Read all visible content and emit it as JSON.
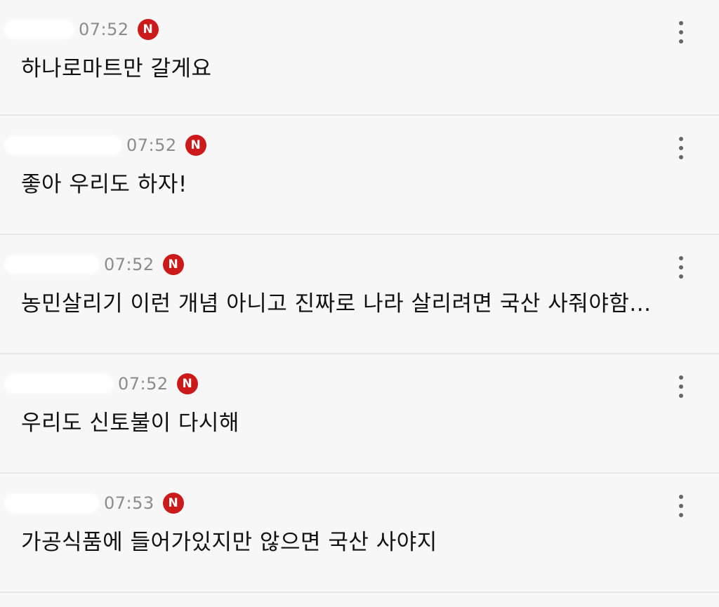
{
  "comments": [
    {
      "time": "07:52",
      "badge": "N",
      "text": "하나로마트만 갈게요"
    },
    {
      "time": "07:52",
      "badge": "N",
      "text": "좋아 우리도 하자!"
    },
    {
      "time": "07:52",
      "badge": "N",
      "text": "농민살리기 이런 개념 아니고 진짜로 나라 살리려면 국산 사줘야함..."
    },
    {
      "time": "07:52",
      "badge": "N",
      "text": "우리도 신토불이 다시해"
    },
    {
      "time": "07:53",
      "badge": "N",
      "text": "가공식품에 들어가있지만 않으면 국산 사야지"
    }
  ],
  "colors": {
    "background": "#f7f7f7",
    "badge": "#cc1a1a",
    "timestamp": "#8c8c8c",
    "text": "#111111",
    "divider": "#e6e6e6"
  },
  "icons": {
    "badge": "naver-n-icon",
    "menu": "more-vertical-icon"
  }
}
